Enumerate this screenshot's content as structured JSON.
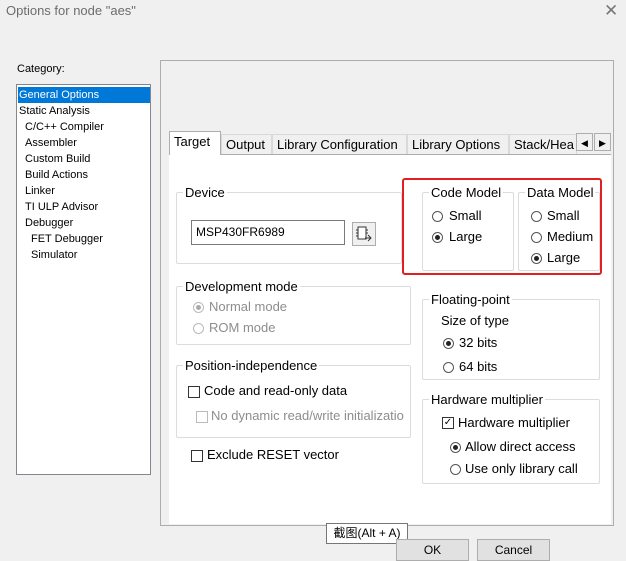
{
  "window": {
    "title": "Options for node \"aes\"",
    "close_glyph": "✕"
  },
  "category": {
    "label": "Category:",
    "items": [
      {
        "label": "General Options",
        "selected": true
      },
      {
        "label": "Static Analysis"
      },
      {
        "label": "C/C++ Compiler"
      },
      {
        "label": "Assembler"
      },
      {
        "label": "Custom Build"
      },
      {
        "label": "Build Actions"
      },
      {
        "label": "Linker"
      },
      {
        "label": "TI ULP Advisor"
      },
      {
        "label": "Debugger"
      },
      {
        "label": "FET Debugger"
      },
      {
        "label": "Simulator"
      }
    ]
  },
  "tabs": [
    {
      "label": "Target",
      "active": true
    },
    {
      "label": "Output"
    },
    {
      "label": "Library Configuration"
    },
    {
      "label": "Library Options"
    },
    {
      "label": "Stack/Hea"
    }
  ],
  "tab_arrows": {
    "left": "◀",
    "right": "▶"
  },
  "device": {
    "legend": "Device",
    "value": "MSP430FR6989",
    "picker_icon": "device-picker-icon"
  },
  "code_model": {
    "legend": "Code Model",
    "options": [
      "Small",
      "Large"
    ],
    "selected": "Large"
  },
  "data_model": {
    "legend": "Data Model",
    "options": [
      "Small",
      "Medium",
      "Large"
    ],
    "selected": "Large"
  },
  "dev_mode": {
    "legend": "Development mode",
    "options": [
      "Normal mode",
      "ROM mode"
    ],
    "selected": "Normal mode"
  },
  "floating": {
    "legend": "Floating-point",
    "size_label": "Size of type",
    "options": [
      "32 bits",
      "64 bits"
    ],
    "selected": "32 bits"
  },
  "position_independence": {
    "legend": "Position-independence",
    "code_label": "Code and read-only data",
    "no_dynamic_label": "No dynamic read/write initializatio"
  },
  "hw_mult": {
    "legend": "Hardware multiplier",
    "check_label": "Hardware multiplier",
    "checked": true,
    "options": [
      "Allow direct access",
      "Use only library call"
    ],
    "selected": "Allow direct access"
  },
  "exclude_reset": {
    "label": "Exclude RESET vector",
    "checked": false
  },
  "tooltip": "截图(Alt + A)",
  "buttons": {
    "ok": "OK",
    "cancel": "Cancel"
  },
  "colors": {
    "highlight": "#e02020",
    "selection": "#0078d7"
  }
}
